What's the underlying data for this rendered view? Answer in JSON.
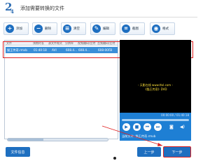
{
  "header": {
    "step_number": "2",
    "step_sub": "4",
    "title": "添加需要转换的文件"
  },
  "toolbar": {
    "buttons": [
      {
        "icon": "+",
        "label": "添加"
      },
      {
        "icon": "−",
        "label": "删除"
      },
      {
        "icon": "≡",
        "label": "清空"
      },
      {
        "icon": "✎",
        "label": "编辑"
      },
      {
        "icon": "⌗",
        "label": "截图"
      },
      {
        "icon": "◉",
        "label": "格式"
      }
    ]
  },
  "file_table": {
    "columns": [
      "文件",
      "预期时长",
      "源文件格式",
      "分辨率",
      "视频编码/比特",
      "音频编码/比特"
    ],
    "rows": [
      {
        "name": "猫王传奇.rmvb",
        "duration": "01:40:18",
        "format": "AVI",
        "resolution": "608.4...",
        "video": "608.4...",
        "audio": "608-00FB"
      }
    ]
  },
  "progress": {
    "value": 0.36
  },
  "preview": {
    "subtitle_line1": "- 天影在线 www.ttxl.com -",
    "subtitle_line2": "《猫王传奇》DVD"
  },
  "player": {
    "time": "00:00:00 / 01:40:18",
    "current_file": "当前文件: 猫王传奇.rmvb"
  },
  "bottom": {
    "file_info_label": "文件信息",
    "prev_label": "上一步",
    "next_label": "下一步"
  },
  "colors": {
    "accent": "#1e6fc0",
    "highlight": "#e02020",
    "selected_row": "#3b8fd8"
  }
}
